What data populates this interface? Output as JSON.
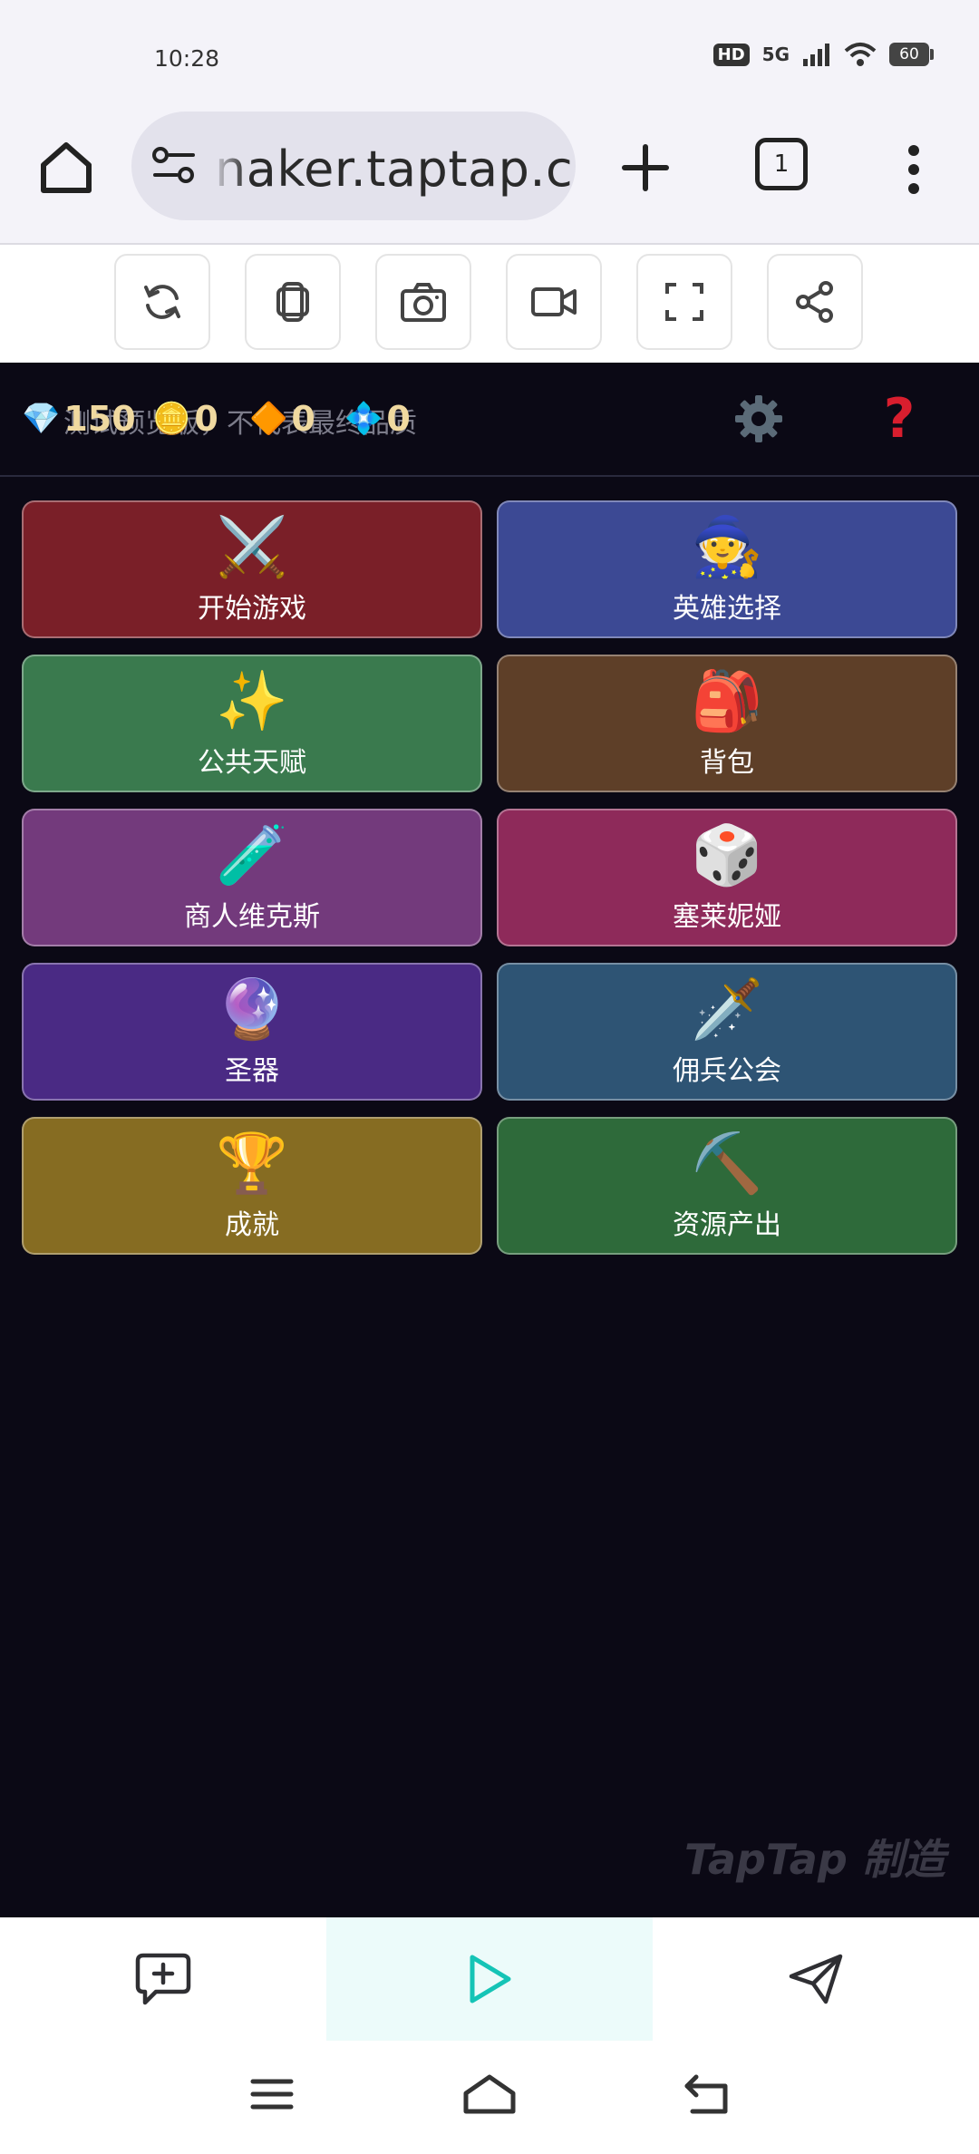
{
  "status": {
    "time": "10:28",
    "hd": "HD",
    "network": "5G",
    "battery": "60"
  },
  "browser": {
    "url": "naker.taptap.cn",
    "tab_count": "1"
  },
  "hud": {
    "watermark": "测试预览版，不代表最终品质",
    "diamonds": "150",
    "coins": "0",
    "orange_gems": "0",
    "blue_crystals": "0",
    "help": "?"
  },
  "menu": [
    {
      "label": "开始游戏",
      "emoji": "⚔️",
      "color": "#7a1f28"
    },
    {
      "label": "英雄选择",
      "emoji": "🧙",
      "color": "#3c4994"
    },
    {
      "label": "公共天赋",
      "emoji": "✨",
      "color": "#3a7a4e"
    },
    {
      "label": "背包",
      "emoji": "🎒",
      "color": "#5e3f28"
    },
    {
      "label": "商人维克斯",
      "emoji": "🧪",
      "color": "#733a7c"
    },
    {
      "label": "塞莱妮娅",
      "emoji": "🎲",
      "color": "#8e2a5a"
    },
    {
      "label": "圣器",
      "emoji": "🔮",
      "color": "#4a2a84"
    },
    {
      "label": "佣兵公会",
      "emoji": "🗡️",
      "color": "#2e5474"
    },
    {
      "label": "成就",
      "emoji": "🏆",
      "color": "#866c22"
    },
    {
      "label": "资源产出",
      "emoji": "⛏️",
      "color": "#2e6a3a"
    }
  ],
  "branding": {
    "watermark": "TapTap 制造"
  },
  "colors": {
    "accent_play": "#15c4b6",
    "help_red": "#d91e2e",
    "game_bg": "#0b0915"
  }
}
